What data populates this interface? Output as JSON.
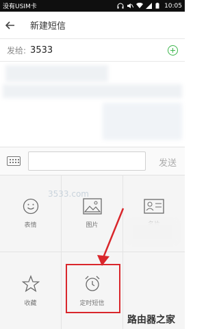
{
  "status_bar": {
    "carrier": "没有USIM卡",
    "time": "10:05"
  },
  "header": {
    "title": "新建短信"
  },
  "recipient": {
    "label": "发给:",
    "value": "3533"
  },
  "compose": {
    "input_value": "",
    "send_label": "发送"
  },
  "panel": {
    "items": [
      {
        "label": "表情",
        "icon": "smiley-icon"
      },
      {
        "label": "图片",
        "icon": "image-icon"
      },
      {
        "label": "名片",
        "icon": "contact-card-icon"
      },
      {
        "label": "收藏",
        "icon": "star-icon"
      },
      {
        "label": "定时短信",
        "icon": "alarm-clock-icon"
      }
    ]
  },
  "watermark": {
    "text": "路由器之家",
    "faint": "3533.com"
  },
  "colors": {
    "highlight": "#d9262b",
    "accent_green": "#3ab54a"
  }
}
